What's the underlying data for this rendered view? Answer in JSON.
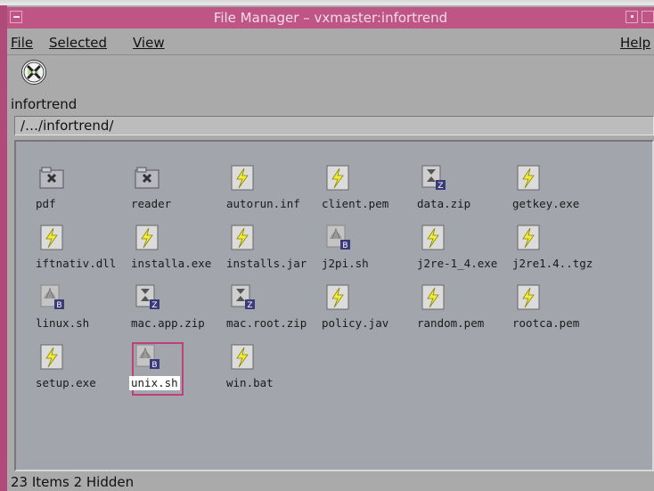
{
  "window": {
    "title": "File Manager – vxmaster:infortrend"
  },
  "menu": {
    "file": "File",
    "selected": "Selected",
    "view": "View",
    "help": "Help"
  },
  "host": {
    "label": "infortrend"
  },
  "path": {
    "value": "/…/infortrend/"
  },
  "files": [
    {
      "name": "pdf",
      "type": "folder"
    },
    {
      "name": "reader",
      "type": "folder"
    },
    {
      "name": "autorun.inf",
      "type": "data"
    },
    {
      "name": "client.pem",
      "type": "data"
    },
    {
      "name": "data.zip",
      "type": "zip"
    },
    {
      "name": "getkey.exe",
      "type": "data"
    },
    {
      "name": "iftnativ.dll",
      "type": "data"
    },
    {
      "name": "installa.exe",
      "type": "data"
    },
    {
      "name": "installs.jar",
      "type": "data"
    },
    {
      "name": "j2pi.sh",
      "type": "shell"
    },
    {
      "name": "j2re-1_4.exe",
      "type": "data"
    },
    {
      "name": "j2re1.4..tgz",
      "type": "data"
    },
    {
      "name": "linux.sh",
      "type": "shell"
    },
    {
      "name": "mac.app.zip",
      "type": "zip"
    },
    {
      "name": "mac.root.zip",
      "type": "zip"
    },
    {
      "name": "policy.jav",
      "type": "data"
    },
    {
      "name": "random.pem",
      "type": "data"
    },
    {
      "name": "rootca.pem",
      "type": "data"
    },
    {
      "name": "setup.exe",
      "type": "data"
    },
    {
      "name": "unix.sh",
      "type": "shell",
      "selected": true
    },
    {
      "name": "win.bat",
      "type": "data"
    }
  ],
  "status": {
    "text": "23 Items 2 Hidden"
  },
  "colors": {
    "titlebar": "#bf5585",
    "window_frame": "#b04a78",
    "selection": "#c0407a",
    "pane": "#a3a5ad"
  }
}
